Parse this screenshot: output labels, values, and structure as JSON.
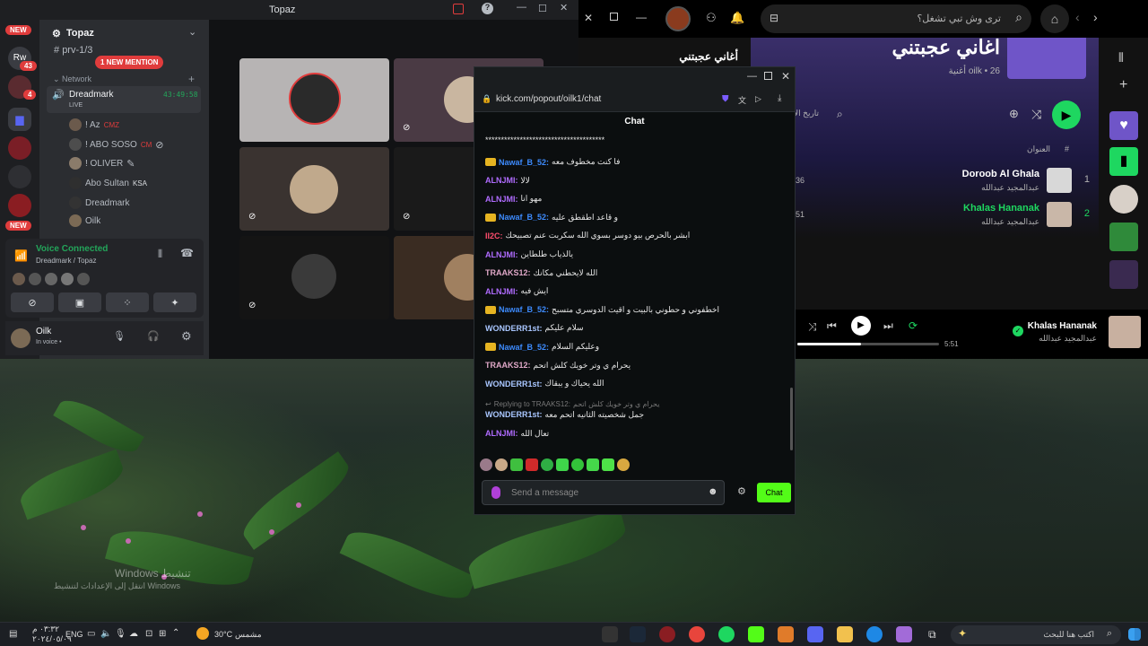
{
  "discord": {
    "title": "Topaz",
    "server_name": "Topaz",
    "channel": "prv-1/3",
    "new_badge": "NEW",
    "mention_pill": "1 NEW MENTION",
    "server_badges": [
      "43",
      "4"
    ],
    "server_letters": "Rw",
    "category": "Network",
    "voice_channel": {
      "name": "Dreadmark",
      "status": "LIVE",
      "timer": "43:49:58"
    },
    "voice_users": [
      {
        "name": "! Az",
        "extra": "CMZ"
      },
      {
        "name": "! ABO SOSO",
        "extra": "CM"
      },
      {
        "name": "! OLIVER",
        "extra": ""
      },
      {
        "name": "Abo Sultan",
        "extra": "KSA"
      },
      {
        "name": "Dreadmark",
        "extra": ""
      },
      {
        "name": "Oilk",
        "extra": ""
      }
    ],
    "voice_connected": {
      "title": "Voice Connected",
      "subtitle": "Dreadmark / Topaz"
    },
    "user": {
      "name": "Oilk",
      "status": "In voice •"
    }
  },
  "spotify": {
    "search_placeholder": "ترى وش تبي تشغل؟",
    "playlist_title": "اغاني عجبتني",
    "sidebar_title": "أغاني عجبتني",
    "meta": "oilk • 26 أغنية",
    "sort_label": "تاريخ الإ",
    "col_title": "العنوان",
    "col_num": "#",
    "tracks": [
      {
        "num": "1",
        "title": "Doroob Al Ghala",
        "artist": "عبدالمجيد عبدالله",
        "dur": "36"
      },
      {
        "num": "2",
        "title": "Khalas Hananak",
        "artist": "عبدالمجيد عبدالله",
        "dur": "51"
      }
    ],
    "now_playing": {
      "title": "Khalas Hananak",
      "artist": "عبدالمجيد عبدالله",
      "time": "5:51"
    },
    "colors": {
      "green": "#1ed760"
    }
  },
  "kick": {
    "url": "kick.com/popout/oilk1/chat",
    "header": "Chat",
    "messages": [
      {
        "user": "",
        "text": "**************************************",
        "color": "#e6e6e6",
        "crown": false
      },
      {
        "user": "Nawaf_B_52:",
        "text": "فا كنت مخطوف معه",
        "color": "#3d8bfd",
        "crown": true
      },
      {
        "user": "ALNJMI:",
        "text": "لالا",
        "color": "#b06cff",
        "crown": false
      },
      {
        "user": "ALNJMI:",
        "text": "مهو انا",
        "color": "#b06cff",
        "crown": false
      },
      {
        "user": "Nawaf_B_52:",
        "text": "و قاعد اطقطق عليه",
        "color": "#3d8bfd",
        "crown": true
      },
      {
        "user": "II2C:",
        "text": "ابشر بالحرص بيو دوسر بسوي الله سكربت عنم تصبيحك",
        "color": "#ff4d6d",
        "crown": false
      },
      {
        "user": "ALNJMI:",
        "text": "يالذياب طلطاين",
        "color": "#b06cff",
        "crown": false
      },
      {
        "user": "TRAAKS12:",
        "text": "الله لايحطني مكانك",
        "color": "#e0a8c8",
        "crown": false
      },
      {
        "user": "ALNJMI:",
        "text": "ايش فيه",
        "color": "#b06cff",
        "crown": false
      },
      {
        "user": "Nawaf_B_52:",
        "text": "اخطفوني و حطوني بالبيت و اقيت الدوسري متسبح",
        "color": "#3d8bfd",
        "crown": true
      },
      {
        "user": "WONDERR1st:",
        "text": "سلام عليكم",
        "color": "#a9c6ff",
        "crown": false
      },
      {
        "user": "Nawaf_B_52:",
        "text": "وعليكم السلام",
        "color": "#3d8bfd",
        "crown": true
      },
      {
        "user": "TRAAKS12:",
        "text": "يحرام ي وتر خويك كلش اتحم",
        "color": "#e0a8c8",
        "crown": false
      },
      {
        "user": "WONDERR1st:",
        "text": "الله يحياك و يبقاك",
        "color": "#a9c6ff",
        "crown": false
      }
    ],
    "reply": {
      "label": "Replying to TRAAKS12:",
      "quote": "يحرام ي وتر خويك كلش اتحم",
      "user": "WONDERR1st:",
      "text": "جمل شخصيته الثانيه اتحم معه",
      "color": "#a9c6ff"
    },
    "last": {
      "user": "ALNJMI:",
      "text": "تعال الله",
      "color": "#b06cff"
    },
    "input_placeholder": "Send a message",
    "chat_button": "Chat",
    "accent": "#53fc18"
  },
  "desktop": {
    "watermark_title": "Windows تنشيط",
    "watermark_sub": "انتقل إلى الإعدادات لتنشيط Windows"
  },
  "taskbar": {
    "search_placeholder": "اكتب هنا للبحث",
    "weather": "30°C",
    "weather_label": "مشمس",
    "lang": "ENG",
    "time": "٠٣:٣٢ م",
    "date": "٢٠٢٤/٠٥/٠٩"
  }
}
